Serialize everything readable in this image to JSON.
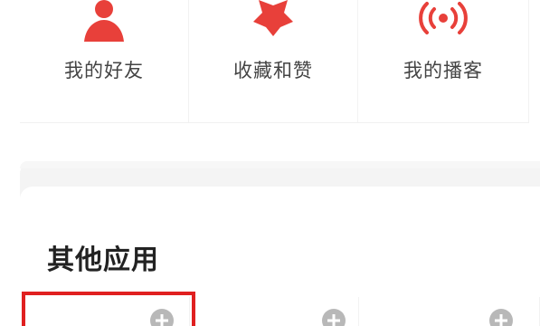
{
  "top_row": {
    "items": [
      {
        "label": "我的好友",
        "icon": "friends-icon"
      },
      {
        "label": "收藏和赞",
        "icon": "star-icon"
      },
      {
        "label": "我的播客",
        "icon": "broadcast-icon"
      }
    ]
  },
  "section": {
    "title": "其他应用"
  },
  "apps": {
    "items": [
      {
        "icon": "add-circle-icon",
        "highlighted": true
      },
      {
        "icon": "add-circle-icon",
        "highlighted": false
      },
      {
        "icon": "add-circle-icon",
        "highlighted": false
      }
    ]
  },
  "colors": {
    "accent_red": "#e8403a",
    "highlight_red": "#e02020",
    "add_icon_gray": "#b8b8b8"
  }
}
